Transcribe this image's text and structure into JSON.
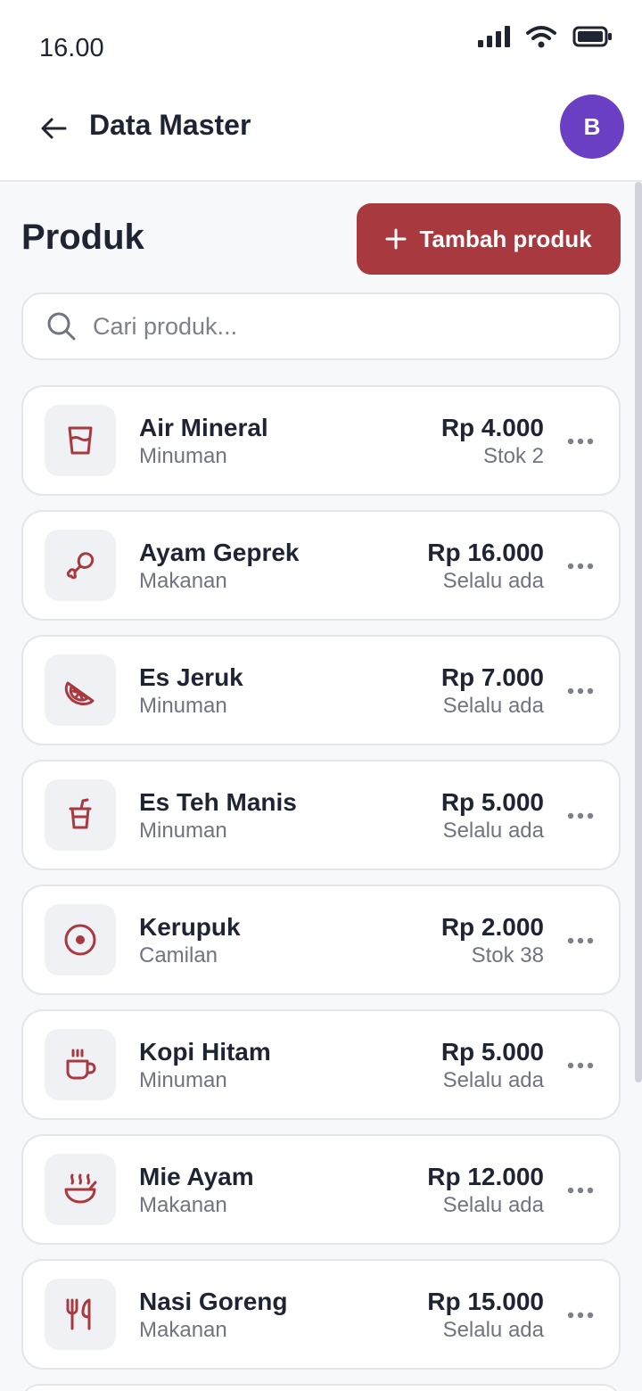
{
  "status_bar": {
    "time": "16.00"
  },
  "app_bar": {
    "title": "Data Master",
    "avatar_initial": "B"
  },
  "page": {
    "title": "Produk",
    "add_button_label": "Tambah produk"
  },
  "search": {
    "placeholder": "Cari produk..."
  },
  "accent_color": "#a8393f",
  "avatar_color": "#6b3fc4",
  "products": [
    {
      "name": "Air Mineral",
      "category": "Minuman",
      "price": "Rp 4.000",
      "stock": "Stok 2",
      "icon": "cup-icon"
    },
    {
      "name": "Ayam Geprek",
      "category": "Makanan",
      "price": "Rp 16.000",
      "stock": "Selalu ada",
      "icon": "drumstick-icon"
    },
    {
      "name": "Es Jeruk",
      "category": "Minuman",
      "price": "Rp 7.000",
      "stock": "Selalu ada",
      "icon": "citrus-icon"
    },
    {
      "name": "Es Teh Manis",
      "category": "Minuman",
      "price": "Rp 5.000",
      "stock": "Selalu ada",
      "icon": "straw-cup-icon"
    },
    {
      "name": "Kerupuk",
      "category": "Camilan",
      "price": "Rp 2.000",
      "stock": "Stok 38",
      "icon": "cracker-icon"
    },
    {
      "name": "Kopi Hitam",
      "category": "Minuman",
      "price": "Rp 5.000",
      "stock": "Selalu ada",
      "icon": "coffee-icon"
    },
    {
      "name": "Mie Ayam",
      "category": "Makanan",
      "price": "Rp 12.000",
      "stock": "Selalu ada",
      "icon": "soup-icon"
    },
    {
      "name": "Nasi Goreng",
      "category": "Makanan",
      "price": "Rp 15.000",
      "stock": "Selalu ada",
      "icon": "utensils-icon"
    }
  ]
}
